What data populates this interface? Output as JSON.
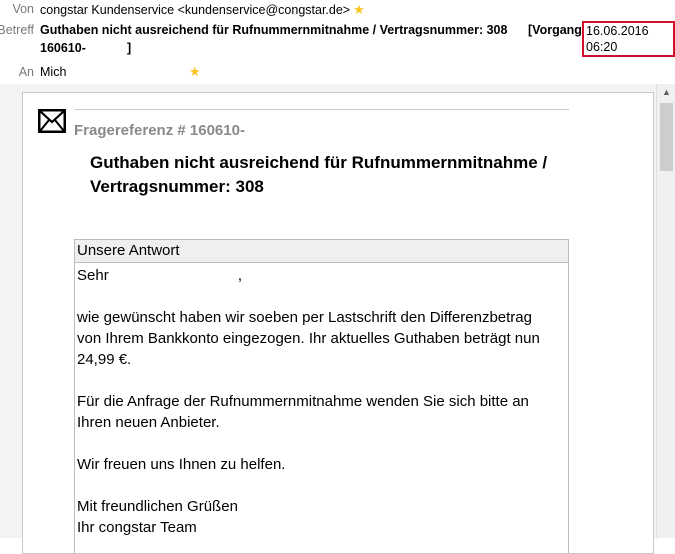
{
  "header": {
    "from_label": "Von",
    "from_value": "congstar Kundenservice <kundenservice@congstar.de>",
    "subject_label": "Betreff",
    "subject_line1": "Guthaben nicht ausreichend für Rufnummernmitnahme / Vertragsnummer: 308",
    "vorgang_label": "[Vorgang:",
    "date_value": "16.06.2016 06:20",
    "subject_line2": "160610-",
    "subject_line2_end": "]",
    "to_label": "An",
    "to_value": "Mich"
  },
  "message": {
    "reference": "Fragereferenz # 160610-",
    "title_line1": "Guthaben nicht ausreichend für Rufnummernmitnahme /",
    "title_line2": "Vertragsnummer: 308",
    "answer_heading": "Unsere Antwort",
    "greeting_start": "Sehr",
    "greeting_end": ",",
    "paragraph1_line1": "wie gewünscht haben wir soeben per Lastschrift den Differenzbetrag",
    "paragraph1_line2": "von Ihrem Bankkonto eingezogen. Ihr aktuelles Guthaben beträgt nun",
    "paragraph1_line3": "24,99 €.",
    "paragraph2_line1": "Für die Anfrage der Rufnummernmitnahme wenden Sie sich bitte an",
    "paragraph2_line2": "Ihren neuen Anbieter.",
    "paragraph3": "Wir freuen uns Ihnen zu helfen.",
    "closing_line1": "Mit freundlichen Grüßen",
    "closing_line2": "Ihr congstar Team"
  },
  "icons": {
    "star": "star-icon",
    "envelope": "envelope-icon",
    "scroll_up": "chevron-up-icon"
  },
  "colors": {
    "date_highlight": "#d0112b",
    "star": "#f5c518",
    "label_gray": "#7a7a7a"
  }
}
